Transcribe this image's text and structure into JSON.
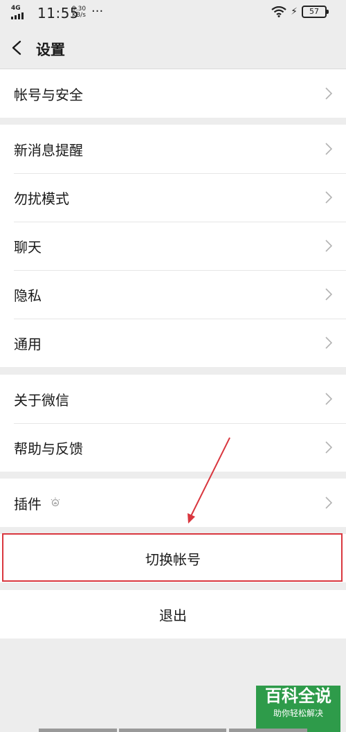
{
  "status_bar": {
    "network": "4G",
    "time": "11:55",
    "speed_value": "9.30",
    "speed_unit": "KB/s",
    "dots": "···",
    "battery": "57"
  },
  "nav": {
    "title": "设置"
  },
  "groups": [
    {
      "items": [
        {
          "label": "帐号与安全"
        }
      ]
    },
    {
      "items": [
        {
          "label": "新消息提醒"
        },
        {
          "label": "勿扰模式"
        },
        {
          "label": "聊天"
        },
        {
          "label": "隐私"
        },
        {
          "label": "通用"
        }
      ]
    },
    {
      "items": [
        {
          "label": "关于微信"
        },
        {
          "label": "帮助与反馈"
        }
      ]
    },
    {
      "items": [
        {
          "label": "插件"
        }
      ]
    }
  ],
  "actions": {
    "switch_account": "切换帐号",
    "logout": "退出"
  },
  "watermark": {
    "title": "百科全说",
    "subtitle": "助你轻松解决"
  },
  "colors": {
    "highlight": "#d9363e",
    "watermark": "#2e9b4a"
  }
}
